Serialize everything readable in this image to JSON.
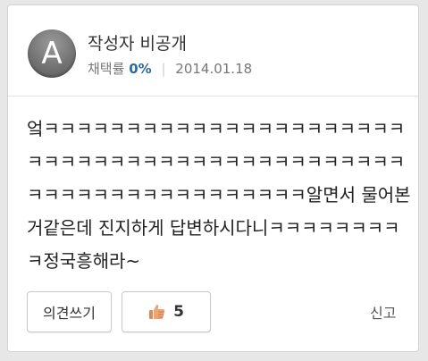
{
  "author": {
    "avatar_letter": "A",
    "name": "작성자 비공개",
    "adoption_label": "채택률",
    "adoption_rate": "0%",
    "separator": "|",
    "date": "2014.01.18"
  },
  "content": {
    "text": "엌ㅋㅋㅋㅋㅋㅋㅋㅋㅋㅋㅋㅋㅋㅋㅋㅋㅋㅋㅋㅋㅋㅋㅋㅋㅋㅋㅋㅋㅋㅋㅋㅋㅋㅋㅋㅋㅋㅋㅋㅋㅋㅋㅋㅋㅋㅋㅋㅋㅋㅋㅋㅋㅋㅋㅋㅋㅋㅋㅋㅋㅋㅋ알면서 물어본거같은데 진지하게 답변하시다니ㅋㅋㅋㅋㅋㅋㅋㅋㅋ정국흥해라~"
  },
  "actions": {
    "opinion_label": "의견쓰기",
    "like_icon": "thumbs-up-icon",
    "like_count": "5",
    "report_label": "신고"
  },
  "colors": {
    "accent": "#2c6aa0",
    "thumb": "#e8a06a"
  }
}
